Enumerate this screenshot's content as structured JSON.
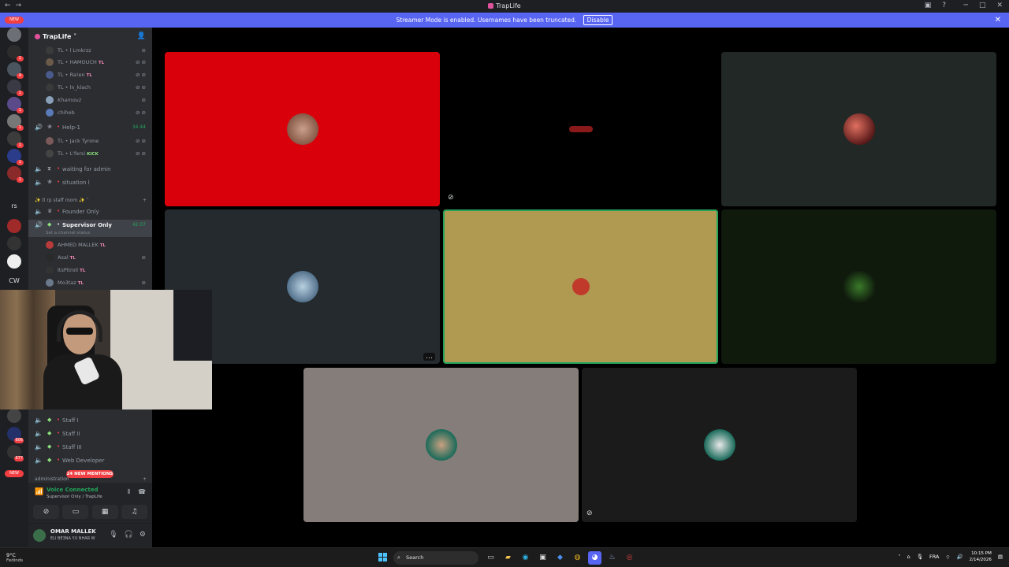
{
  "window": {
    "title": "TrapLife"
  },
  "banner": {
    "text": "Streamer Mode is enabled. Usernames have been truncated.",
    "disable_label": "Disable"
  },
  "servers": {
    "items": [
      {
        "badge": "NEW"
      },
      {
        "badge": "1"
      },
      {
        "badge": "4"
      },
      {
        "badge": "1"
      },
      {
        "badge": "1"
      },
      {
        "badge": "1"
      },
      {
        "badge": "1"
      },
      {
        "badge": "1"
      },
      {
        "badge": ""
      },
      {
        "badge": "1"
      }
    ],
    "text_items": [
      "rs",
      "CW"
    ],
    "lower_badges": [
      "NEW",
      "606",
      "677"
    ],
    "bottom_new": "NEW"
  },
  "sidebar": {
    "server_name": "TrapLife",
    "members_top": [
      {
        "prefix": "TL",
        "name": "l Lmkrzz",
        "tag": "",
        "tag_class": ""
      },
      {
        "prefix": "TL",
        "name": "HAMOUCH",
        "tag": "TL",
        "tag_class": ""
      },
      {
        "prefix": "TL",
        "name": "Ra!en",
        "tag": "TL",
        "tag_class": ""
      },
      {
        "prefix": "TL",
        "name": "ln_klach",
        "tag": "",
        "tag_class": ""
      },
      {
        "prefix": "",
        "name": "Khamouz",
        "tag": "",
        "tag_class": ""
      },
      {
        "prefix": "",
        "name": "chiheb",
        "tag": "",
        "tag_class": ""
      }
    ],
    "help_channel": {
      "name": "Help-1",
      "timer": "34:44"
    },
    "help_members": [
      {
        "prefix": "TL",
        "name": "Jack Tyrone",
        "tag": "",
        "tag_class": ""
      },
      {
        "prefix": "TL",
        "name": "L'fersi",
        "tag": "KICK",
        "tag_class": "green"
      }
    ],
    "voice_channels_a": [
      "waiting for admin",
      "situation l"
    ],
    "category_staff": "tl rp staff room",
    "founder_only": "Founder Only",
    "supervisor": {
      "name": "Supervisor Only",
      "timer": "42:07",
      "status": "Set a channel status"
    },
    "supervisor_members": [
      {
        "name": "AHMED MALLEK",
        "tag": "TL"
      },
      {
        "name": "Asal",
        "tag": "TL"
      },
      {
        "name": "ItsPitroli",
        "tag": "TL"
      },
      {
        "name": "Mo3taz",
        "tag": "TL"
      }
    ],
    "staff_channels": [
      "Staff I",
      "Staff II",
      "Staff III",
      "Web Developer"
    ],
    "category_admin": "administration",
    "mentions_pill": "24 NEW MENTIONS"
  },
  "voice_panel": {
    "title": "Voice Connected",
    "subtitle": "Supervisor Only / TrapLife"
  },
  "user_panel": {
    "name": "OMAR MALLEK",
    "status": "ELI BE3NA Y.II NHAR W"
  },
  "taskbar": {
    "weather_temp": "9°C",
    "weather_desc": "Fedinds",
    "search_placeholder": "Search",
    "lang": "FRA",
    "time": "10:15 PM",
    "date": "2/14/2026"
  },
  "colors": {
    "tile_red": "#d9000c",
    "tile_gold": "#b09a52",
    "tile_green": "#0f1a0c",
    "tile_taupe": "#857d7a",
    "accent_blurple": "#5865f2",
    "voice_green": "#23a55a"
  }
}
